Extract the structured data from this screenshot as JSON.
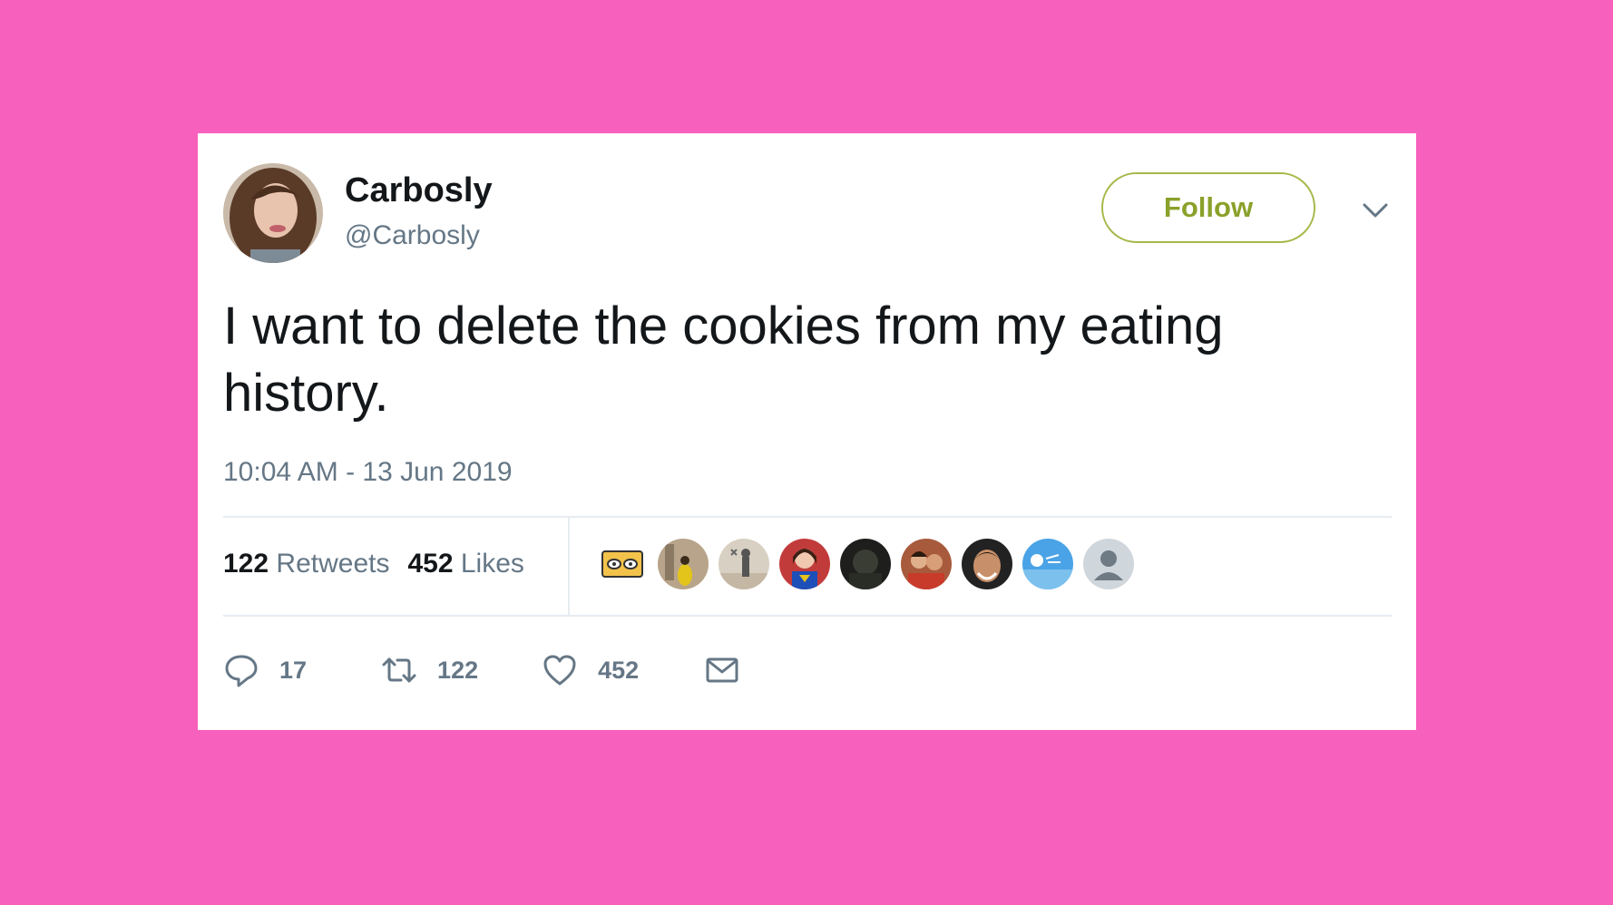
{
  "tweet": {
    "author": {
      "name": "Carbosly",
      "handle": "@Carbosly"
    },
    "follow_label": "Follow",
    "text": "I want to delete the cookies from my eating history.",
    "timestamp": "10:04 AM - 13 Jun 2019",
    "stats": {
      "retweets_count": "122",
      "retweets_label": "Retweets",
      "likes_count": "452",
      "likes_label": "Likes"
    },
    "likers_count": 9,
    "actions": {
      "replies": "17",
      "retweets": "122",
      "likes": "452"
    }
  },
  "icons": [
    "chevron-down-icon",
    "reply-icon",
    "retweet-icon",
    "heart-icon",
    "mail-icon"
  ],
  "colors": {
    "background": "#f760bd",
    "card": "#ffffff",
    "follow_accent": "#8aa12a",
    "secondary_text": "#657786",
    "primary_text": "#14171a"
  }
}
